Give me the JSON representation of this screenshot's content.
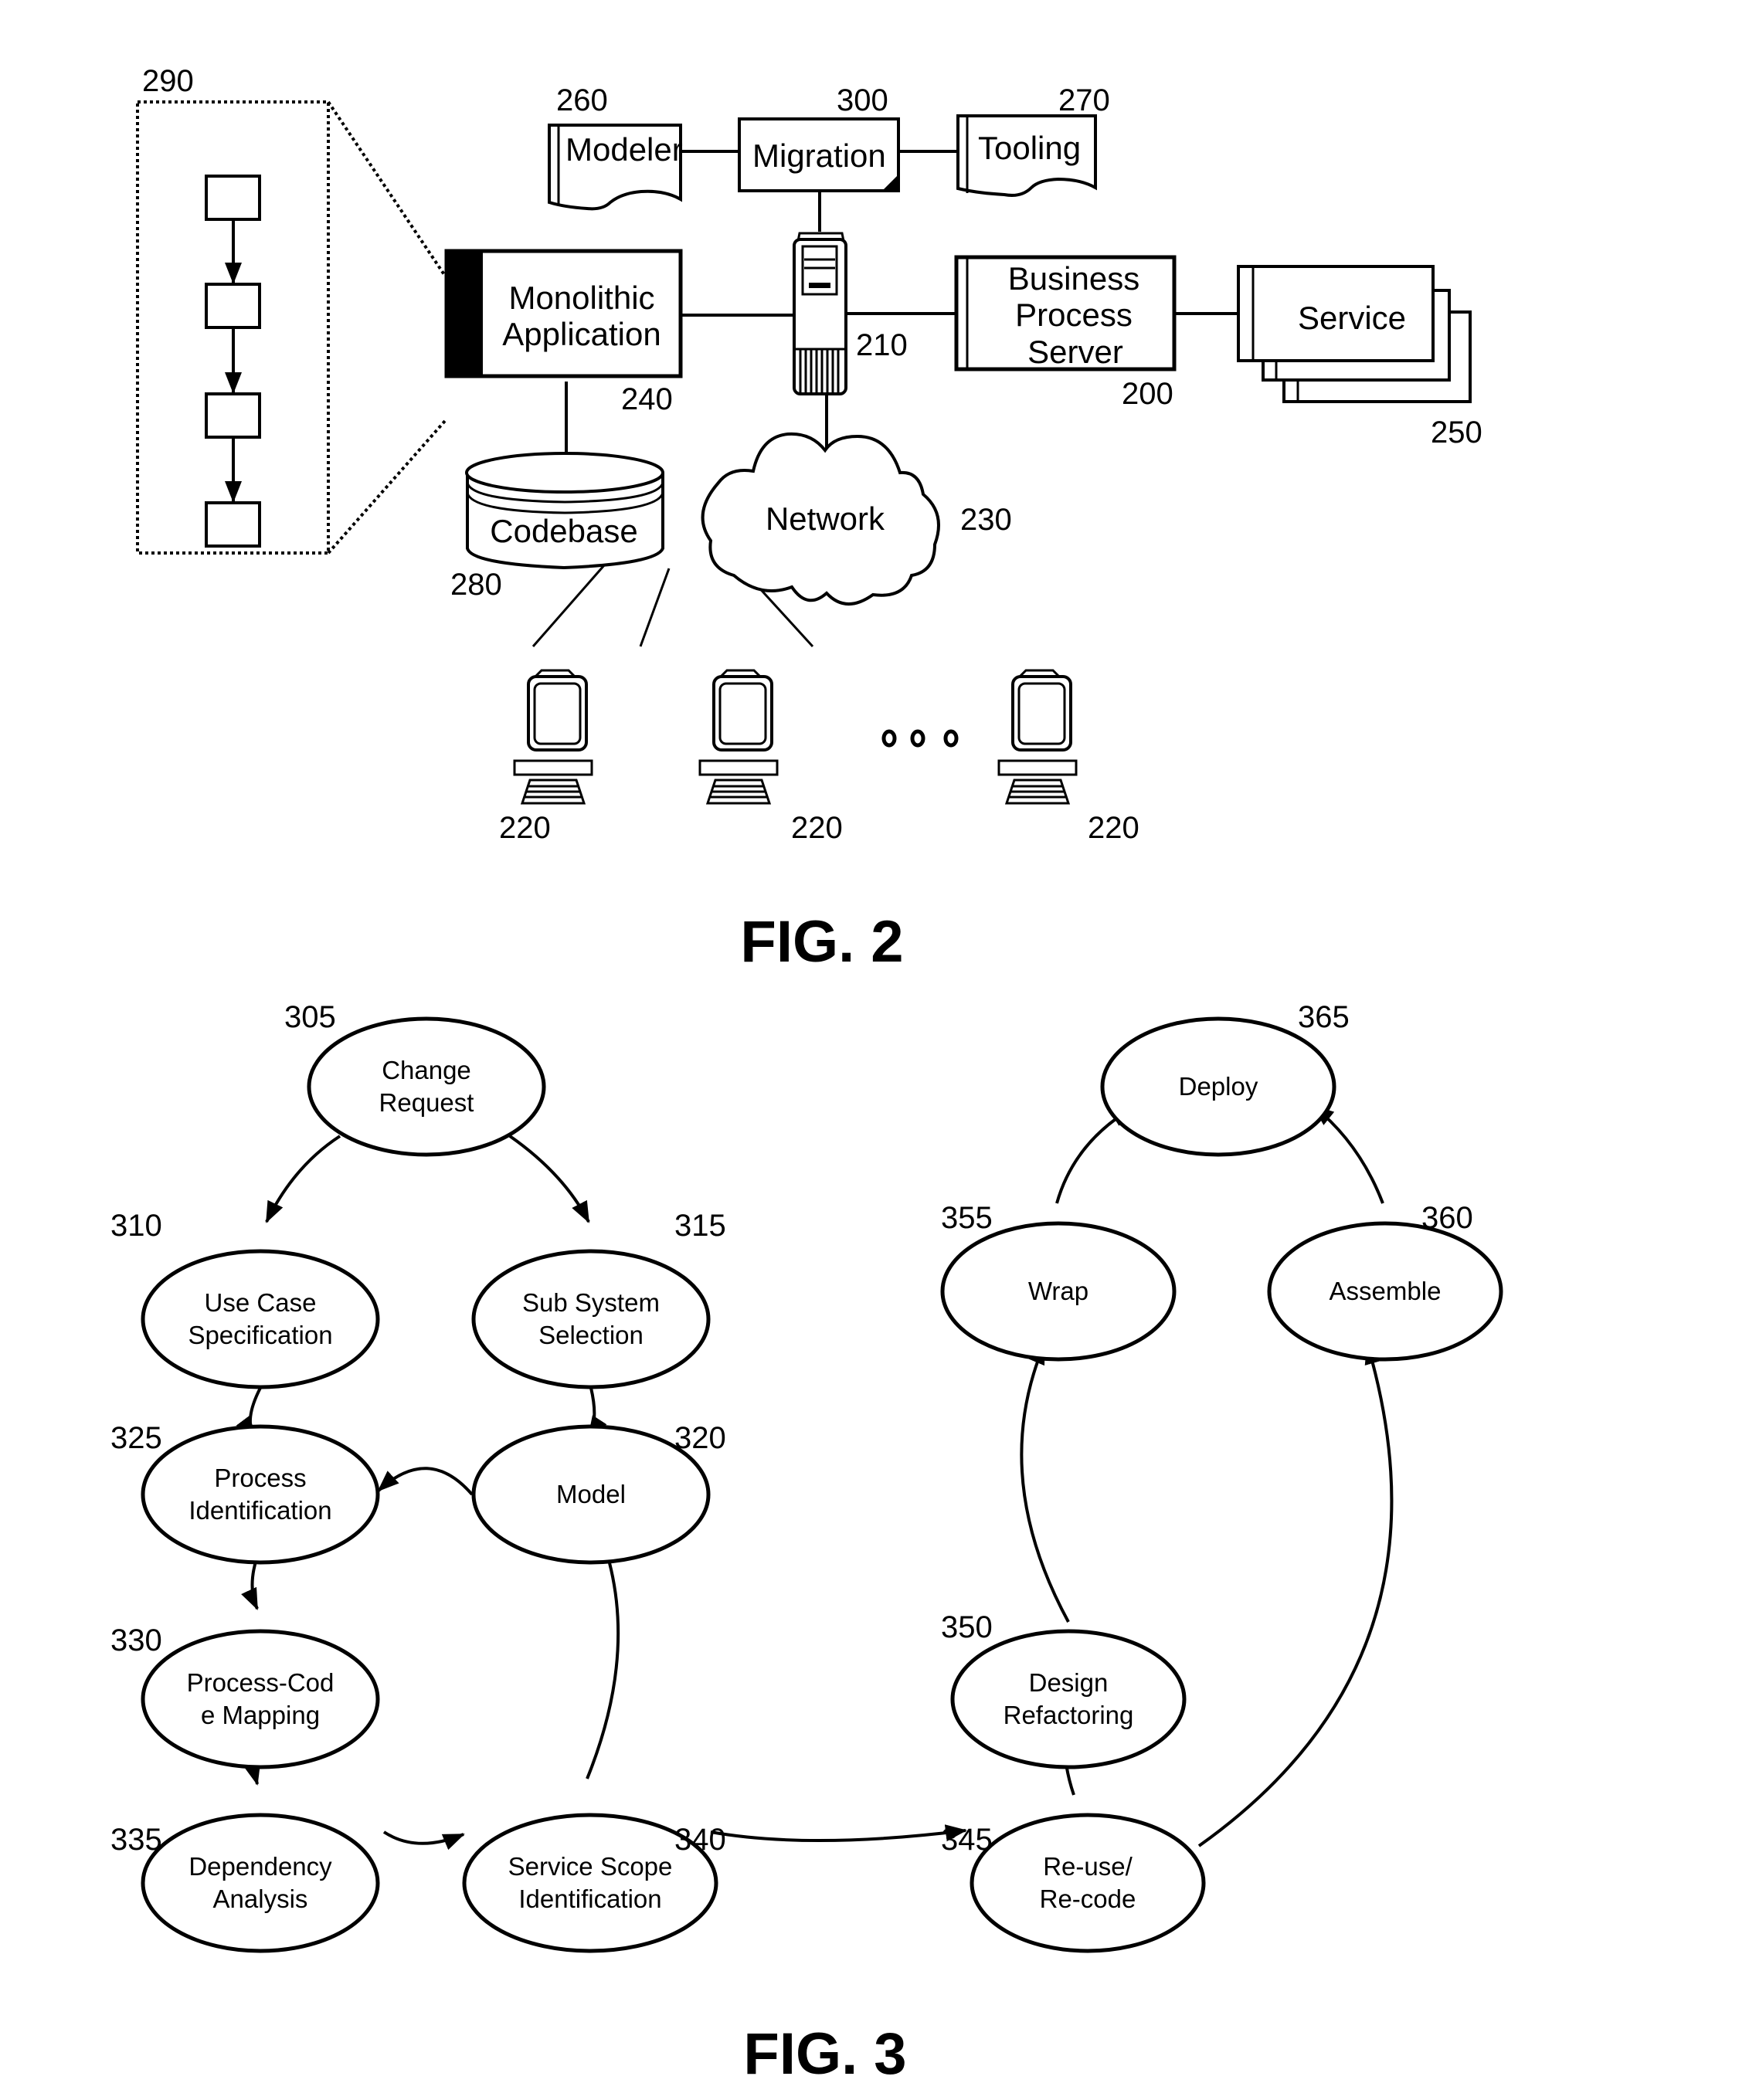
{
  "figure2": {
    "caption": "FIG. 2",
    "nodes": {
      "process_detail": {
        "ref": "290"
      },
      "monolithic_app": {
        "line1": "Monolithic",
        "line2": "Application",
        "ref": "240"
      },
      "codebase": {
        "label": "Codebase",
        "ref": "280"
      },
      "modeler": {
        "label": "Modeler",
        "ref": "260"
      },
      "migration": {
        "label": "Migration",
        "ref": "300"
      },
      "tooling": {
        "label": "Tooling",
        "ref": "270"
      },
      "server": {
        "ref": "210"
      },
      "bps": {
        "line1": "Business",
        "line2": "Process",
        "line3": "Server",
        "ref": "200"
      },
      "services": {
        "label": "Service",
        "ref": "250"
      },
      "network": {
        "label": "Network",
        "ref": "230"
      },
      "clients": [
        {
          "ref": "220"
        },
        {
          "ref": "220"
        },
        {
          "ref": "220"
        }
      ],
      "ellipsis": "ooo"
    }
  },
  "figure3": {
    "caption": "FIG. 3",
    "nodes": [
      {
        "id": "n305",
        "ref": "305",
        "lines": [
          "Change",
          "Request"
        ]
      },
      {
        "id": "n310",
        "ref": "310",
        "lines": [
          "Use Case",
          "Specification"
        ]
      },
      {
        "id": "n315",
        "ref": "315",
        "lines": [
          "Sub System",
          "Selection"
        ]
      },
      {
        "id": "n320",
        "ref": "320",
        "lines": [
          "Model"
        ]
      },
      {
        "id": "n325",
        "ref": "325",
        "lines": [
          "Process",
          "Identification"
        ]
      },
      {
        "id": "n330",
        "ref": "330",
        "lines": [
          "Process-Cod",
          "e Mapping"
        ]
      },
      {
        "id": "n335",
        "ref": "335",
        "lines": [
          "Dependency",
          "Analysis"
        ]
      },
      {
        "id": "n340",
        "ref": "340",
        "lines": [
          "Service Scope",
          "Identification"
        ]
      },
      {
        "id": "n345",
        "ref": "345",
        "lines": [
          "Re-use/",
          "Re-code"
        ]
      },
      {
        "id": "n350",
        "ref": "350",
        "lines": [
          "Design",
          "Refactoring"
        ]
      },
      {
        "id": "n355",
        "ref": "355",
        "lines": [
          "Wrap"
        ]
      },
      {
        "id": "n360",
        "ref": "360",
        "lines": [
          "Assemble"
        ]
      },
      {
        "id": "n365",
        "ref": "365",
        "lines": [
          "Deploy"
        ]
      }
    ]
  }
}
